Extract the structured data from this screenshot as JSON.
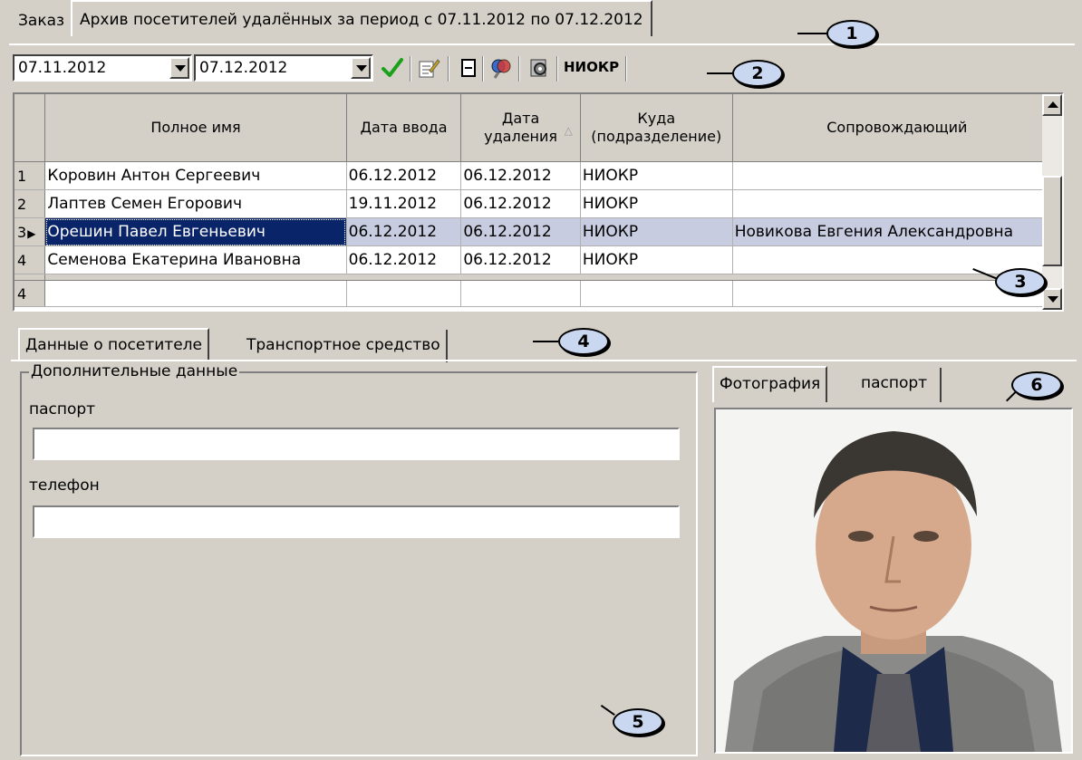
{
  "top_tabs": [
    {
      "label": "Заказ",
      "active": false
    },
    {
      "label": "Архив посетителей удалённых за период с 07.11.2012 по 07.12.2012",
      "active": true
    }
  ],
  "toolbar": {
    "date_from": "07.11.2012",
    "date_to": "07.12.2012",
    "icons": [
      "apply-check-icon",
      "edit-form-icon",
      "collapse-icon",
      "search-icon",
      "settings-icon"
    ],
    "dept_label": "НИОКР"
  },
  "grid": {
    "columns": [
      "Полное имя",
      "Дата ввода",
      "Дата удаления",
      "Куда (подразделение)",
      "Сопровождающий"
    ],
    "rows": [
      {
        "num": "1",
        "name": "Коровин Антон Сергеевич",
        "entered": "06.12.2012",
        "deleted": "06.12.2012",
        "dept": "НИОКР",
        "escort": ""
      },
      {
        "num": "2",
        "name": "Лаптев Семен Егорович",
        "entered": "19.11.2012",
        "deleted": "06.12.2012",
        "dept": "НИОКР",
        "escort": ""
      },
      {
        "num": "3",
        "name": "Орешин Павел Евгеньевич",
        "entered": "06.12.2012",
        "deleted": "06.12.2012",
        "dept": "НИОКР",
        "escort": "Новикова Евгения Александровна",
        "selected": true
      },
      {
        "num": "4",
        "name": "Семенова Екатерина Ивановна",
        "entered": "06.12.2012",
        "deleted": "06.12.2012",
        "dept": "НИОКР",
        "escort": ""
      }
    ],
    "footer_count": "4"
  },
  "lower_tabs": [
    {
      "label": "Данные о посетителе",
      "active": true
    },
    {
      "label": "Транспортное средство",
      "active": false
    }
  ],
  "details": {
    "group_title": "Дополнительные данные",
    "passport_label": "паспорт",
    "passport_value": "",
    "phone_label": "телефон",
    "phone_value": ""
  },
  "photo_tabs": [
    {
      "label": "Фотография",
      "active": true
    },
    {
      "label": "паспорт",
      "active": false
    }
  ],
  "callouts": [
    "1",
    "2",
    "3",
    "4",
    "5",
    "6"
  ],
  "colors": {
    "selection": "#0a246a",
    "highlight": "#c8cce0",
    "callout_fill": "#c9d8f0",
    "face": "#d4d0c8"
  }
}
